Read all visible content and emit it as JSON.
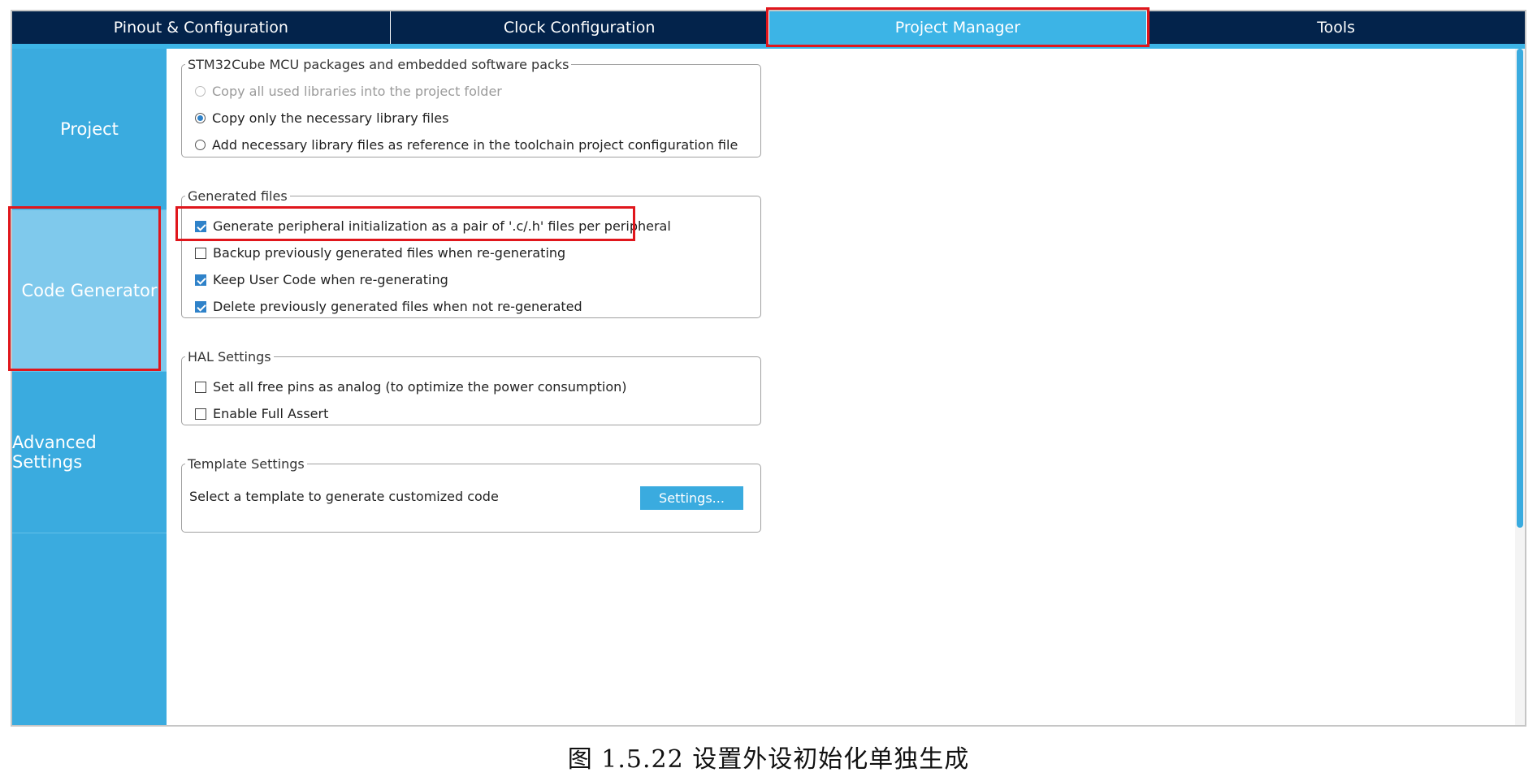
{
  "tabs": [
    {
      "label": "Pinout & Configuration"
    },
    {
      "label": "Clock Configuration"
    },
    {
      "label": "Project Manager"
    },
    {
      "label": "Tools"
    }
  ],
  "sidenav": {
    "items": [
      {
        "label": "Project"
      },
      {
        "label": "Code Generator"
      },
      {
        "label": "Advanced Settings"
      }
    ]
  },
  "packs": {
    "legend": "STM32Cube MCU packages and embedded software packs",
    "options": [
      {
        "label": "Copy all used libraries into the project folder",
        "selected": false,
        "disabled": true
      },
      {
        "label": "Copy only the necessary library files",
        "selected": true,
        "disabled": false
      },
      {
        "label": "Add necessary library files as reference in the toolchain project configuration file",
        "selected": false,
        "disabled": false
      }
    ]
  },
  "generated": {
    "legend": "Generated files",
    "options": [
      {
        "label": "Generate peripheral initialization as a pair of '.c/.h' files per peripheral",
        "checked": true
      },
      {
        "label": "Backup previously generated files when re-generating",
        "checked": false
      },
      {
        "label": "Keep User Code when re-generating",
        "checked": true
      },
      {
        "label": "Delete previously generated files when not re-generated",
        "checked": true
      }
    ]
  },
  "hal": {
    "legend": "HAL Settings",
    "options": [
      {
        "label": "Set all free pins as analog (to optimize the power consumption)",
        "checked": false
      },
      {
        "label": "Enable Full Assert",
        "checked": false
      }
    ]
  },
  "template": {
    "legend": "Template Settings",
    "text": "Select a template to generate customized code",
    "button": "Settings..."
  },
  "caption": "图 1.5.22 设置外设初始化单独生成"
}
